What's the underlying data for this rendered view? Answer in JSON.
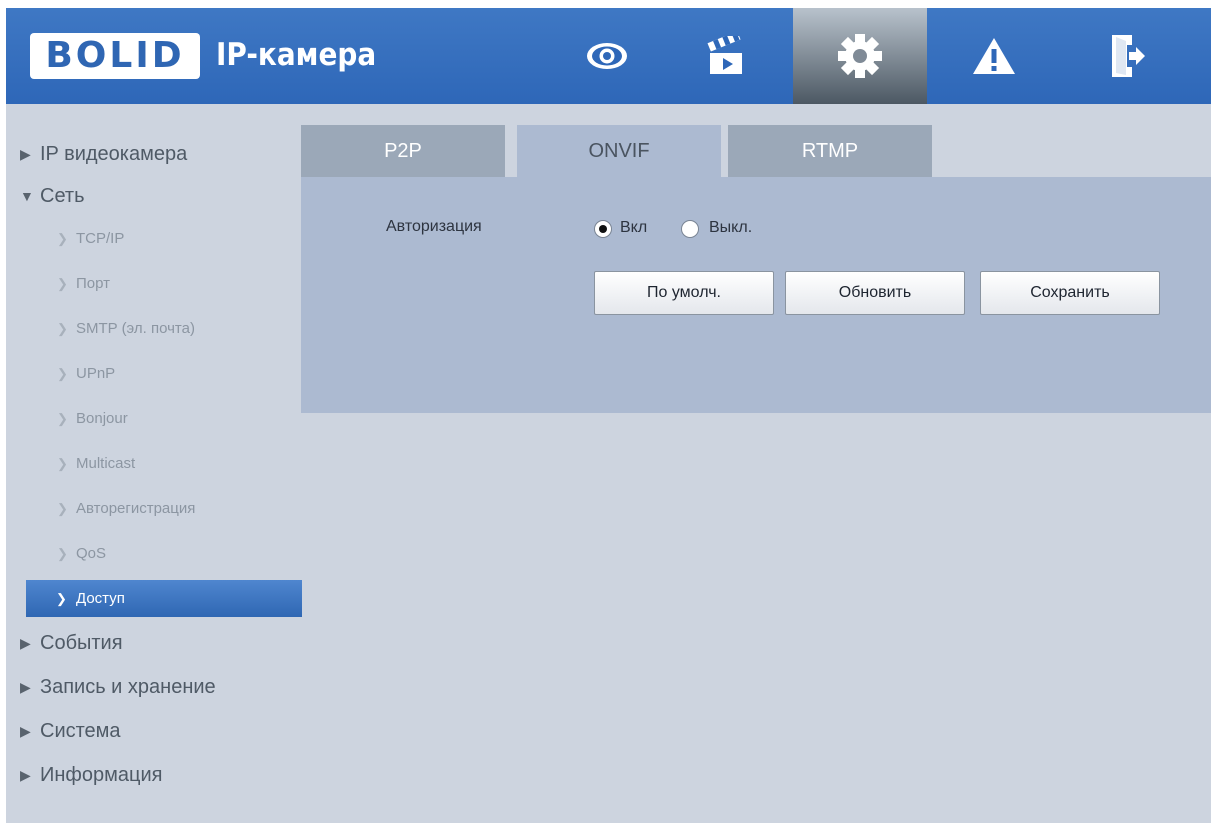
{
  "header": {
    "logo_text": "BOLID",
    "title": "IP-камера",
    "nav": [
      {
        "icon": "eye-icon",
        "label": "live-view"
      },
      {
        "icon": "clapperboard-icon",
        "label": "playback"
      },
      {
        "icon": "gear-icon",
        "label": "settings",
        "active": true
      },
      {
        "icon": "warning-icon",
        "label": "alarm"
      },
      {
        "icon": "logout-icon",
        "label": "logout"
      }
    ]
  },
  "sidebar": {
    "sections": [
      {
        "label": "IP видеокамера",
        "expanded": false
      },
      {
        "label": "Сеть",
        "expanded": true
      },
      {
        "label": "События",
        "expanded": false
      },
      {
        "label": "Запись и хранение",
        "expanded": false
      },
      {
        "label": "Система",
        "expanded": false
      },
      {
        "label": "Информация",
        "expanded": false
      }
    ],
    "network_items": [
      "TCP/IP",
      "Порт",
      "SMTP (эл. почта)",
      "UPnP",
      "Bonjour",
      "Multicast",
      "Авторегистрация",
      "QoS",
      "Доступ"
    ],
    "active_item": "Доступ"
  },
  "tabs": [
    {
      "label": "P2P",
      "active": false
    },
    {
      "label": "ONVIF",
      "active": true
    },
    {
      "label": "RTMP",
      "active": false
    }
  ],
  "form": {
    "auth_label": "Авторизация",
    "on_label": "Вкл",
    "off_label": "Выкл.",
    "selected": "Вкл"
  },
  "buttons": {
    "default_label": "По умолч.",
    "refresh_label": "Обновить",
    "save_label": "Сохранить"
  },
  "colors": {
    "header_blue": "#3f78c4",
    "panel": "#acbad1",
    "background": "#cdd4df",
    "active_item": "#3c75c2"
  }
}
